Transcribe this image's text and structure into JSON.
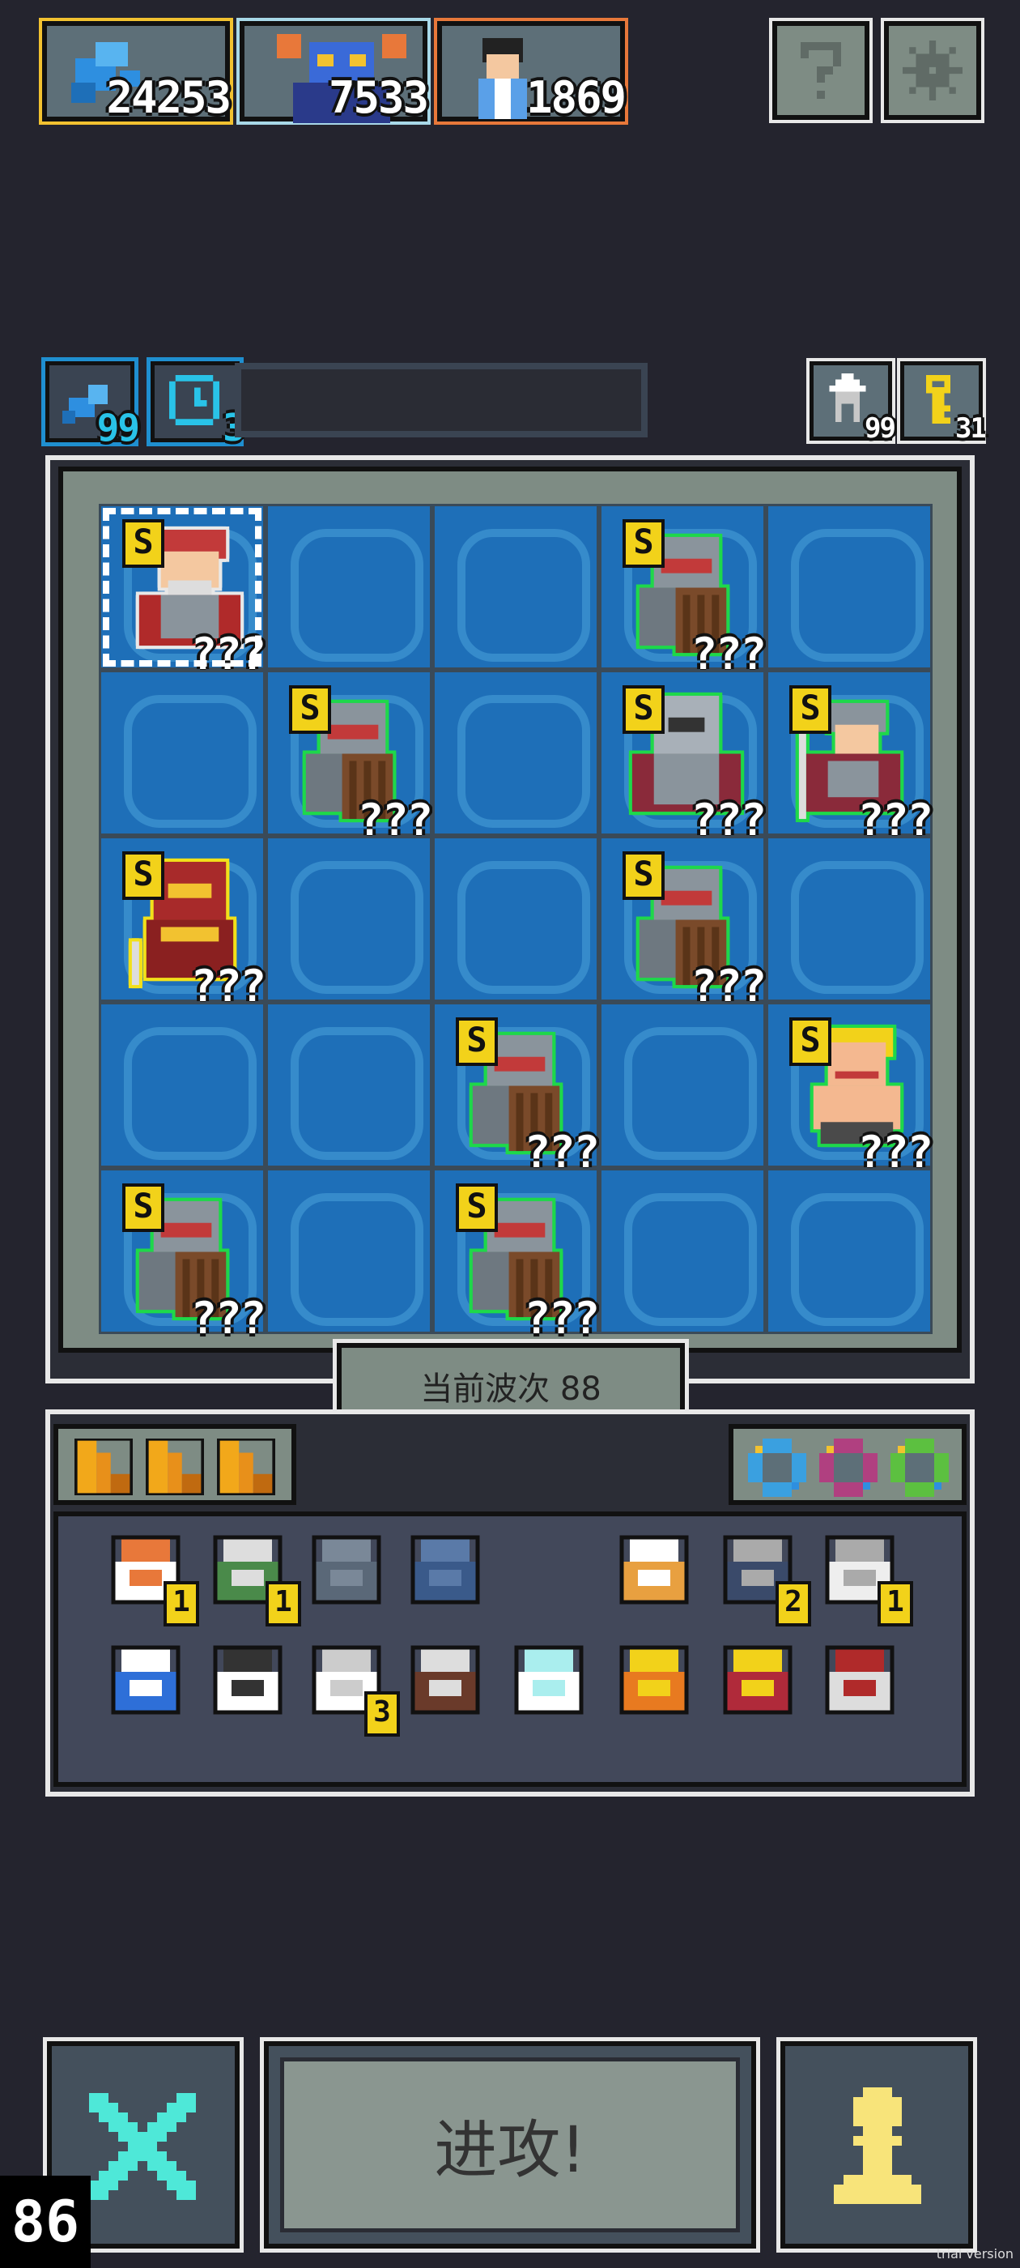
{
  "resources": [
    {
      "icon": "blue-bird-icon",
      "value": "24253",
      "accent": "#f2c230"
    },
    {
      "icon": "demon-lord-icon",
      "value": "7533",
      "accent": "#a8d8e8"
    },
    {
      "icon": "villager-icon",
      "value": "1869",
      "accent": "#e8783a"
    }
  ],
  "top_buttons": [
    {
      "icon": "help-icon"
    },
    {
      "icon": "settings-icon"
    }
  ],
  "boosts": [
    {
      "icon": "wing-icon",
      "value": "99"
    },
    {
      "icon": "timer-icon",
      "value": "3"
    }
  ],
  "stocks": [
    {
      "icon": "house-icon",
      "value": "99"
    },
    {
      "icon": "key-icon",
      "value": "31"
    }
  ],
  "grid": {
    "rank": "S",
    "unknown": "???",
    "units": [
      {
        "row": 0,
        "col": 0,
        "type": "red-general",
        "outline": "#e8e8e8"
      },
      {
        "row": 0,
        "col": 3,
        "type": "shield-knight",
        "outline": "#1ed84a"
      },
      {
        "row": 1,
        "col": 1,
        "type": "shield-knight",
        "outline": "#1ed84a"
      },
      {
        "row": 1,
        "col": 3,
        "type": "armored-knight",
        "outline": "#1ed84a"
      },
      {
        "row": 1,
        "col": 4,
        "type": "spear-soldier",
        "outline": "#1ed84a"
      },
      {
        "row": 2,
        "col": 0,
        "type": "red-knight",
        "outline": "#f2e01a"
      },
      {
        "row": 2,
        "col": 3,
        "type": "shield-knight",
        "outline": "#1ed84a"
      },
      {
        "row": 3,
        "col": 2,
        "type": "shield-knight",
        "outline": "#1ed84a"
      },
      {
        "row": 3,
        "col": 4,
        "type": "barbarian",
        "outline": "#1ed84a"
      },
      {
        "row": 4,
        "col": 0,
        "type": "shield-knight",
        "outline": "#1ed84a"
      },
      {
        "row": 4,
        "col": 2,
        "type": "shield-knight",
        "outline": "#1ed84a"
      }
    ]
  },
  "wave": {
    "label": "当前波次 88"
  },
  "cards": [
    "card-icon",
    "card-icon",
    "card-icon"
  ],
  "gems": [
    {
      "icon": "blue-gem-icon",
      "color": "#3aa0e0"
    },
    {
      "icon": "purple-gem-icon",
      "color": "#b04080"
    },
    {
      "icon": "green-gem-icon",
      "color": "#5cc040"
    }
  ],
  "items": [
    {
      "icon": "chef-icon",
      "count": "1"
    },
    {
      "icon": "plague-doctor-icon",
      "count": "1"
    },
    {
      "icon": "shield-icon",
      "count": ""
    },
    {
      "icon": "gauntlet-icon",
      "count": ""
    },
    {
      "icon": "ship-icon",
      "count": ""
    },
    {
      "icon": "castle-icon",
      "count": "2"
    },
    {
      "icon": "anvil-icon",
      "count": "1"
    },
    {
      "icon": "potion-icon",
      "count": ""
    },
    {
      "icon": "ghost-icon",
      "count": ""
    },
    {
      "icon": "cloud-icon",
      "count": "3"
    },
    {
      "icon": "crate-icon",
      "count": ""
    },
    {
      "icon": "ice-crystal-icon",
      "count": ""
    },
    {
      "icon": "treasure-map-icon",
      "count": ""
    },
    {
      "icon": "red-boot-icon",
      "count": ""
    },
    {
      "icon": "battle-axe-icon",
      "count": ""
    }
  ],
  "actions": {
    "cancel_icon": "cross-icon",
    "attack_label": "进攻!",
    "unit_icon": "pawn-icon"
  },
  "fps": "86",
  "watermark": "trial version"
}
